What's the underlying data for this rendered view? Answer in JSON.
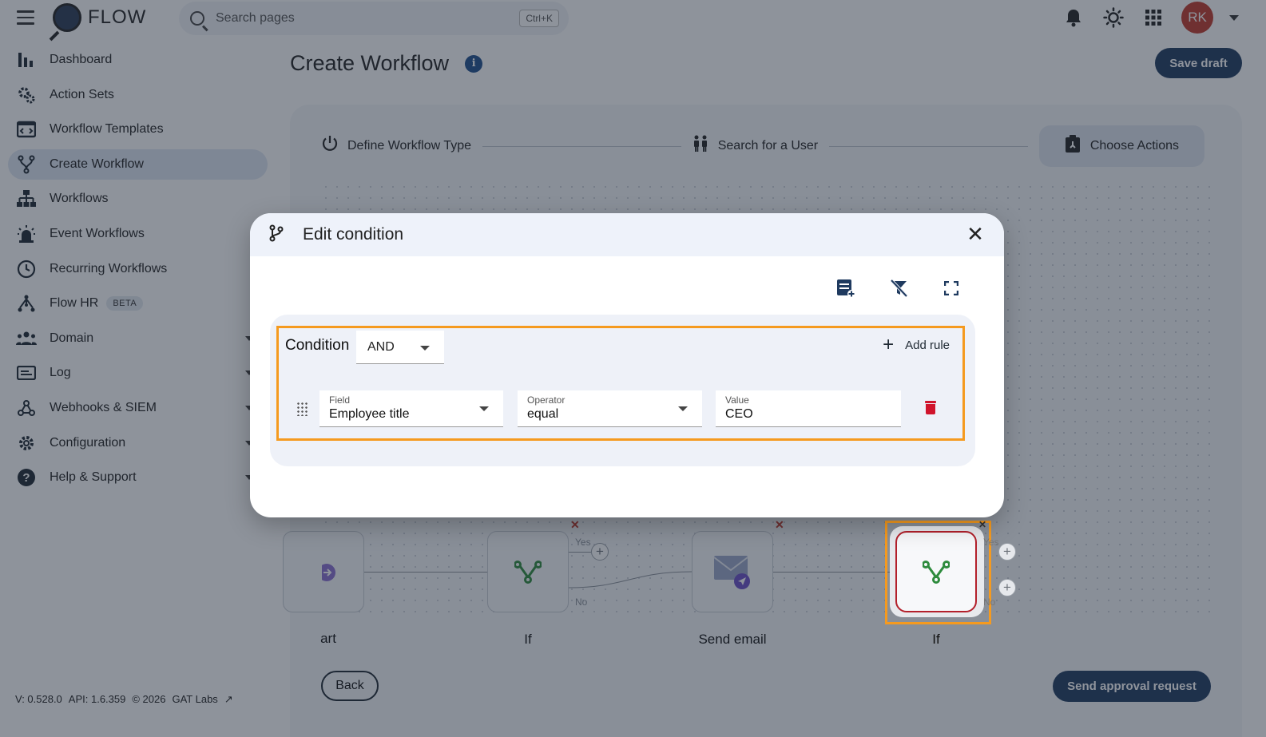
{
  "brand": {
    "name": "FLOW"
  },
  "search": {
    "placeholder": "Search pages",
    "shortcut": "Ctrl+K"
  },
  "user": {
    "initials": "RK"
  },
  "sidebar": {
    "items": [
      {
        "label": "Dashboard",
        "icon": "bar-chart-icon"
      },
      {
        "label": "Action Sets",
        "icon": "gears-icon"
      },
      {
        "label": "Workflow Templates",
        "icon": "template-icon"
      },
      {
        "label": "Create Workflow",
        "icon": "fork-icon",
        "active": true
      },
      {
        "label": "Workflows",
        "icon": "hierarchy-icon"
      },
      {
        "label": "Event Workflows",
        "icon": "alarm-icon"
      },
      {
        "label": "Recurring Workflows",
        "icon": "clock-icon"
      },
      {
        "label": "Flow HR",
        "icon": "people-tree-icon",
        "badge": "BETA"
      },
      {
        "label": "Domain",
        "icon": "group-icon",
        "expandable": true
      },
      {
        "label": "Log",
        "icon": "log-icon",
        "expandable": true
      },
      {
        "label": "Webhooks & SIEM",
        "icon": "webhook-icon",
        "expandable": true
      },
      {
        "label": "Configuration",
        "icon": "gear-icon",
        "expandable": true
      },
      {
        "label": "Help & Support",
        "icon": "help-icon",
        "expandable": true
      }
    ]
  },
  "footer": {
    "version": "V: 0.528.0",
    "api": "API: 1.6.359",
    "copyright": "© 2026",
    "company": "GAT Labs"
  },
  "page": {
    "title": "Create Workflow",
    "save_draft": "Save draft"
  },
  "stepper": {
    "steps": [
      {
        "label": "Define Workflow Type"
      },
      {
        "label": "Search for a User"
      },
      {
        "label": "Choose Actions",
        "active": true
      }
    ]
  },
  "canvas": {
    "nodes": [
      {
        "label": "art"
      },
      {
        "label": "If"
      },
      {
        "label": "Send email"
      },
      {
        "label": "If"
      }
    ],
    "branch_yes": "Yes",
    "branch_no": "No"
  },
  "actions": {
    "back": "Back",
    "send": "Send approval request"
  },
  "dialog": {
    "title": "Edit condition",
    "condition_label": "Condition",
    "combinator": "AND",
    "add_rule": "Add rule",
    "rule": {
      "field_label": "Field",
      "field_value": "Employee title",
      "operator_label": "Operator",
      "operator_value": "equal",
      "value_label": "Value",
      "value_value": "CEO"
    }
  },
  "colors": {
    "primary": "#1f3a5f",
    "highlight": "#f59a1f",
    "danger": "#d0142c",
    "node_green": "#2e8b3d"
  }
}
